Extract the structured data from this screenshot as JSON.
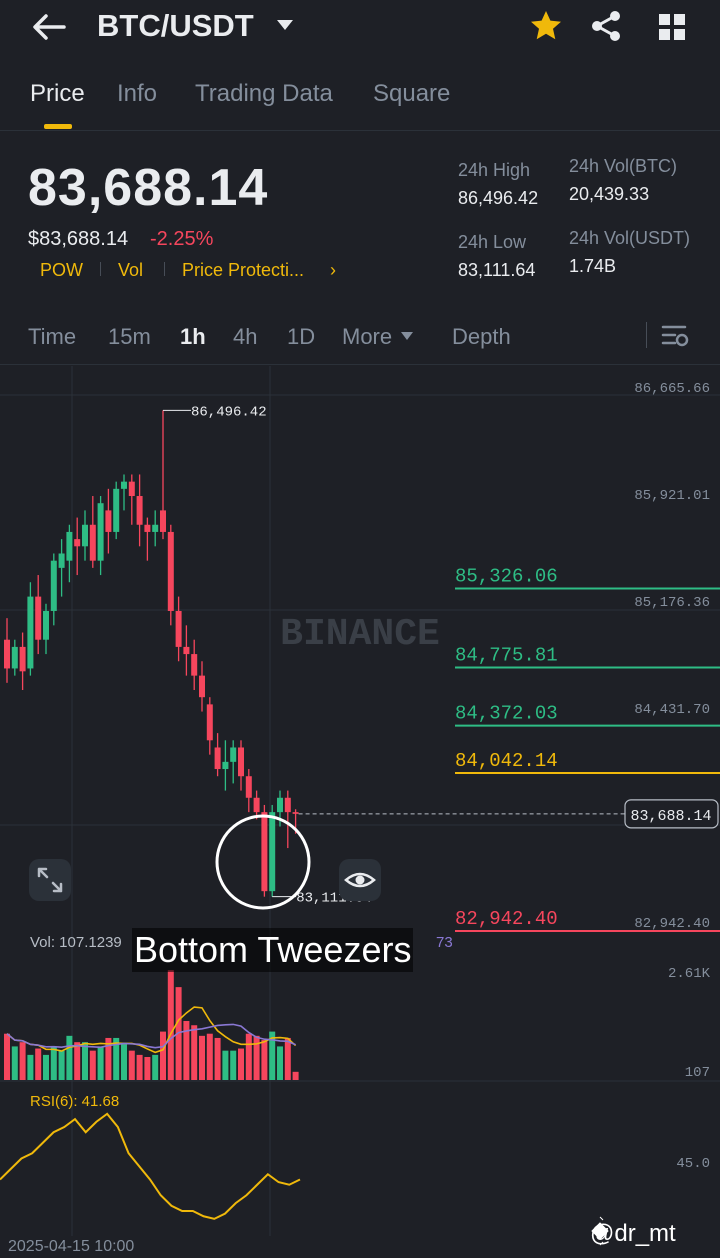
{
  "header": {
    "back_icon": "arrow-left-icon",
    "pair": "BTC/USDT",
    "favorite_icon": "star-icon",
    "share_icon": "share-icon",
    "grid_icon": "grid-icon",
    "favorite_color": "#f0b90b"
  },
  "tabs": [
    {
      "label": "Price",
      "active": true
    },
    {
      "label": "Info"
    },
    {
      "label": "Trading Data"
    },
    {
      "label": "Square"
    }
  ],
  "price": {
    "last": "83,688.14",
    "usd": "$83,688.14",
    "change_pct": "-2.25%",
    "tags": [
      "POW",
      "Vol",
      "Price Protecti..."
    ],
    "tags_more": "›"
  },
  "stats": {
    "high_label": "24h High",
    "high_value": "86,496.42",
    "low_label": "24h Low",
    "low_value": "83,111.64",
    "vol_btc_label": "24h Vol(BTC)",
    "vol_btc_value": "20,439.33",
    "vol_usdt_label": "24h Vol(USDT)",
    "vol_usdt_value": "1.74B"
  },
  "intervals": [
    {
      "label": "Time"
    },
    {
      "label": "15m"
    },
    {
      "label": "1h",
      "active": true
    },
    {
      "label": "4h"
    },
    {
      "label": "1D"
    },
    {
      "label": "More"
    },
    {
      "label": "Depth"
    }
  ],
  "chart": {
    "watermark": "BINANCE",
    "axis_labels": [
      "86,665.66",
      "85,921.01",
      "85,176.36",
      "84,431.70",
      "82,942.40"
    ],
    "current_price_tag": "83,688.14",
    "high_marker": "86,496.42",
    "low_marker": "83,111.64",
    "levels": [
      {
        "value": "85,326.06",
        "color": "#2ebd85"
      },
      {
        "value": "84,775.81",
        "color": "#2ebd85"
      },
      {
        "value": "84,372.03",
        "color": "#2ebd85"
      },
      {
        "value": "84,042.14",
        "color": "#f0b90b"
      },
      {
        "value": "82,942.40",
        "color": "#f6465d"
      }
    ],
    "annotation": "Bottom Tweezers",
    "vol_label": "Vol: 107.1239",
    "vol_label_tail": "73",
    "vol_axis": [
      "2.61K",
      "107"
    ],
    "rsi_label": "RSI(6): 41.68",
    "rsi_axis": "45.0",
    "date": "2025-04-15 10:00",
    "handle": "@dr_mt",
    "up_color": "#2ebd85",
    "down_color": "#f6465d"
  },
  "chart_data": {
    "type": "candlestick",
    "xlabel": "",
    "ylabel": "",
    "ylim": [
      82942.4,
      86665.66
    ],
    "ticks": [
      86665.66,
      85921.01,
      85176.36,
      84431.7,
      82942.4
    ],
    "levels": [
      85326.06,
      84775.81,
      84372.03,
      84042.14,
      82942.4
    ],
    "high": 86496.42,
    "low": 83111.64,
    "last": 83688.14,
    "candles": [
      {
        "o": 84900,
        "h": 85050,
        "c": 84700,
        "l": 84600
      },
      {
        "o": 84700,
        "h": 84900,
        "c": 84850,
        "l": 84650
      },
      {
        "o": 84850,
        "h": 84950,
        "c": 84680,
        "l": 84550
      },
      {
        "o": 84700,
        "h": 85300,
        "c": 85200,
        "l": 84650
      },
      {
        "o": 85200,
        "h": 85350,
        "c": 84900,
        "l": 84800
      },
      {
        "o": 84900,
        "h": 85150,
        "c": 85100,
        "l": 84800
      },
      {
        "o": 85100,
        "h": 85500,
        "c": 85450,
        "l": 85000
      },
      {
        "o": 85400,
        "h": 85600,
        "c": 85500,
        "l": 85200
      },
      {
        "o": 85450,
        "h": 85700,
        "c": 85650,
        "l": 85300
      },
      {
        "o": 85600,
        "h": 85750,
        "c": 85550,
        "l": 85350
      },
      {
        "o": 85550,
        "h": 85800,
        "c": 85700,
        "l": 85450
      },
      {
        "o": 85700,
        "h": 85900,
        "c": 85450,
        "l": 85400
      },
      {
        "o": 85450,
        "h": 85900,
        "c": 85850,
        "l": 85350
      },
      {
        "o": 85800,
        "h": 85950,
        "c": 85650,
        "l": 85500
      },
      {
        "o": 85650,
        "h": 86000,
        "c": 85950,
        "l": 85600
      },
      {
        "o": 85950,
        "h": 86050,
        "c": 86000,
        "l": 85800
      },
      {
        "o": 86000,
        "h": 86050,
        "c": 85900,
        "l": 85700
      },
      {
        "o": 85900,
        "h": 86050,
        "c": 85700,
        "l": 85550
      },
      {
        "o": 85700,
        "h": 85750,
        "c": 85650,
        "l": 85450
      },
      {
        "o": 85650,
        "h": 85800,
        "c": 85700,
        "l": 85550
      },
      {
        "o": 85800,
        "h": 86496.42,
        "c": 85650,
        "l": 85600
      },
      {
        "o": 85650,
        "h": 85700,
        "c": 85100,
        "l": 85000
      },
      {
        "o": 85100,
        "h": 85200,
        "c": 84850,
        "l": 84750
      },
      {
        "o": 84850,
        "h": 85000,
        "c": 84800,
        "l": 84650
      },
      {
        "o": 84800,
        "h": 84900,
        "c": 84650,
        "l": 84550
      },
      {
        "o": 84650,
        "h": 84750,
        "c": 84500,
        "l": 84400
      },
      {
        "o": 84450,
        "h": 84500,
        "c": 84200,
        "l": 84100
      },
      {
        "o": 84150,
        "h": 84250,
        "c": 84000,
        "l": 83950
      },
      {
        "o": 84000,
        "h": 84200,
        "c": 84050,
        "l": 83850
      },
      {
        "o": 84050,
        "h": 84200,
        "c": 84150,
        "l": 83900
      },
      {
        "o": 84150,
        "h": 84200,
        "c": 83950,
        "l": 83850
      },
      {
        "o": 83950,
        "h": 84000,
        "c": 83800,
        "l": 83700
      },
      {
        "o": 83800,
        "h": 83850,
        "c": 83700,
        "l": 83650
      },
      {
        "o": 83700,
        "h": 83750,
        "c": 83150,
        "l": 83111.64
      },
      {
        "o": 83150,
        "h": 83750,
        "c": 83700,
        "l": 83111.64
      },
      {
        "o": 83700,
        "h": 83850,
        "c": 83800,
        "l": 83600
      },
      {
        "o": 83800,
        "h": 83850,
        "c": 83700,
        "l": 83450
      },
      {
        "o": 83700,
        "h": 83720,
        "c": 83688.14,
        "l": 83550
      }
    ],
    "volume": [
      1200,
      900,
      1000,
      700,
      850,
      700,
      900,
      800,
      1150,
      1000,
      1000,
      800,
      900,
      1100,
      1100,
      950,
      800,
      700,
      650,
      700,
      1250,
      2700,
      2300,
      1500,
      1400,
      1150,
      1200,
      1100,
      800,
      800,
      850,
      1200,
      1150,
      1050,
      1250,
      900,
      1100,
      300
    ],
    "volume_ylim": [
      107,
      2610
    ],
    "rsi": [
      50,
      54,
      58,
      60,
      64,
      68,
      70,
      73,
      68,
      72,
      75,
      70,
      60,
      55,
      50,
      44,
      40,
      38,
      38,
      36,
      35,
      37,
      41,
      44,
      48,
      52,
      49,
      48,
      50
    ]
  }
}
